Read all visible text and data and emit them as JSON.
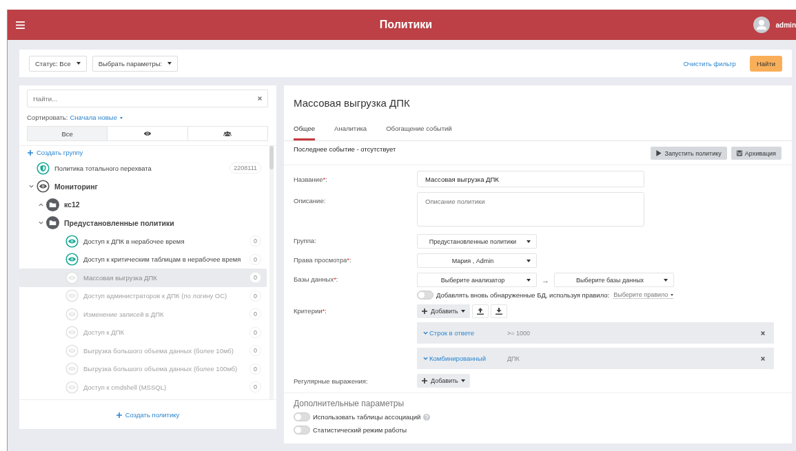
{
  "header": {
    "title": "Политики",
    "user": "admin"
  },
  "filters": {
    "buttons": [
      "Статус: Все",
      "Выбрать параметры:"
    ],
    "clear": "Очистить фильтр",
    "find": "Найти"
  },
  "sidebar": {
    "search": {
      "placeholder": "Найти..."
    },
    "sort_label": "Сортировать:",
    "sort_value": "Сначала новые",
    "view_tabs": [
      {
        "kind": "text",
        "label": "Все",
        "selected": true
      },
      {
        "kind": "eye",
        "selected": false
      },
      {
        "kind": "users",
        "selected": false
      }
    ],
    "create_group": "Создать группу",
    "tree": [
      {
        "kind": "shield",
        "label": "Политика тотального перехвата",
        "count": "2208111",
        "active": true,
        "selected": false
      },
      {
        "kind": "monitor",
        "label": "Мониторинг",
        "expanded": true,
        "children": [
          {
            "kind": "folder",
            "label": "кс12",
            "expanded": false
          },
          {
            "kind": "folder",
            "label": "Предустановленные политики",
            "expanded": true,
            "children": [
              {
                "kind": "policy",
                "label": "Доступ к ДПК в нерабочее время",
                "count": "0",
                "active": true,
                "selected": false
              },
              {
                "kind": "policy",
                "label": "Доступ к критическим таблицам в нерабочее время",
                "count": "0",
                "active": true,
                "selected": false
              },
              {
                "kind": "policy",
                "label": "Массовая выгрузка ДПК",
                "count": "0",
                "active": false,
                "selected": true
              },
              {
                "kind": "policy",
                "label": "Доступ администраторов к ДПК (по логину ОС)",
                "count": "0",
                "active": false,
                "selected": false
              },
              {
                "kind": "policy",
                "label": "Изменение записей в ДПК",
                "count": "0",
                "active": false,
                "selected": false
              },
              {
                "kind": "policy",
                "label": "Доступ к ДПК",
                "count": "0",
                "active": false,
                "selected": false
              },
              {
                "kind": "policy",
                "label": "Выгрузка большого объема данных (более 10мб)",
                "count": "0",
                "active": false,
                "selected": false
              },
              {
                "kind": "policy",
                "label": "Выгрузка большого объема данных (более 100мб)",
                "count": "0",
                "active": false,
                "selected": false
              },
              {
                "kind": "policy",
                "label": "Доступ к cmdshell (MSSQL)",
                "count": "0",
                "active": false,
                "selected": false
              }
            ]
          }
        ]
      }
    ],
    "create_policy": "Создать политику"
  },
  "detail": {
    "title": "Массовая выгрузка ДПК",
    "tabs": [
      {
        "label": "Общее",
        "selected": true
      },
      {
        "label": "Аналитика",
        "selected": false
      },
      {
        "label": "Обогащение событий",
        "selected": false
      }
    ],
    "last_event": "Последнее событие - отсутствует",
    "actions": [
      {
        "kind": "run",
        "label": "Запустить политику"
      },
      {
        "kind": "archive",
        "label": "Архивация"
      }
    ],
    "fields": [
      {
        "kind": "input",
        "label": "Название",
        "required": true,
        "value": "Массовая выгрузка ДПК"
      },
      {
        "kind": "textarea",
        "label": "Описание:",
        "required": false,
        "placeholder": "Описание политики"
      },
      {
        "kind": "select",
        "label": "Группа:",
        "required": false,
        "value": "Предустановленные политики"
      },
      {
        "kind": "select",
        "label": "Права просмотра",
        "required": true,
        "value": "Мария , Admin"
      },
      {
        "kind": "select-pair",
        "label": "Базы данных",
        "required": true,
        "values": [
          "Выберите анализатор",
          "Выберите базы данных"
        ],
        "arrow": "→",
        "toggle": {
          "label": "Добавлять вновь обнаруженные БД, используя правило:",
          "on": false,
          "rule": "Выберите правило"
        }
      },
      {
        "kind": "criteria",
        "label": "Критерии",
        "required": true,
        "add": "Добавить",
        "items": [
          {
            "name": "Строк в ответе",
            "value": ">= 1000"
          },
          {
            "name": "Комбинированный",
            "value": "ДПК"
          }
        ]
      },
      {
        "kind": "add",
        "label": "Регулярные выражения:",
        "required": false,
        "add": "Добавить"
      }
    ],
    "mark": "*",
    "colon": ":",
    "extra_title": "Дополнительные параметры",
    "extra": [
      {
        "label": "Использовать таблицы ассоциаций",
        "on": false,
        "help": true
      },
      {
        "label": "Статистический режим работы",
        "on": false,
        "help": false
      }
    ]
  }
}
